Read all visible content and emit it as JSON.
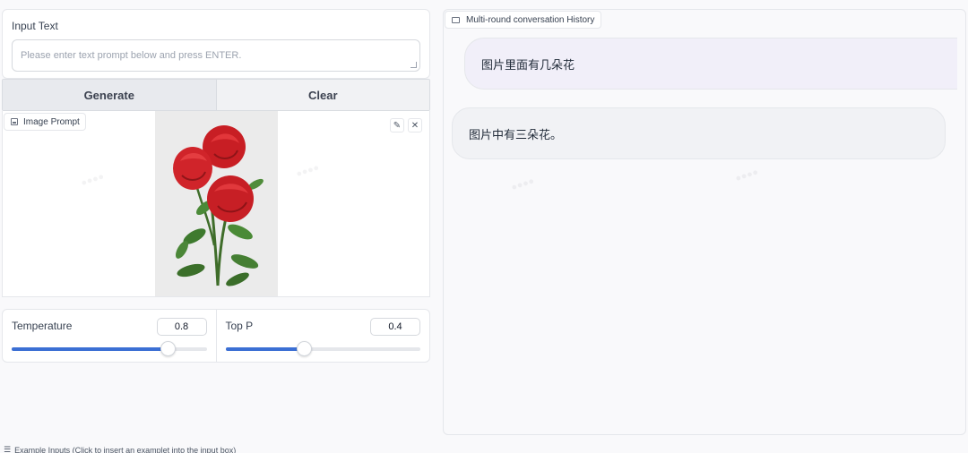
{
  "input": {
    "label": "Input Text",
    "placeholder": "Please enter text prompt below and press ENTER.",
    "value": ""
  },
  "buttons": {
    "generate": "Generate",
    "clear": "Clear"
  },
  "image_prompt": {
    "label": "Image Prompt",
    "image_description": "three red roses"
  },
  "sliders": {
    "temperature": {
      "label": "Temperature",
      "value": "0.8",
      "fraction": 0.8
    },
    "top_p": {
      "label": "Top P",
      "value": "0.4",
      "fraction": 0.4
    }
  },
  "examples": {
    "label": "Example Inputs (Click to insert an examplet into the input box)"
  },
  "chat": {
    "label": "Multi-round conversation History",
    "messages": [
      {
        "role": "user",
        "text": "图片里面有几朵花"
      },
      {
        "role": "bot",
        "text": "图片中有三朵花。"
      }
    ]
  },
  "colors": {
    "accent": "#3b6fd4",
    "user_bubble": "#f1eff9",
    "bot_bubble": "#f1f2f5"
  },
  "icons": [
    "image-icon",
    "pencil-icon",
    "close-icon",
    "chat-icon",
    "list-icon"
  ]
}
